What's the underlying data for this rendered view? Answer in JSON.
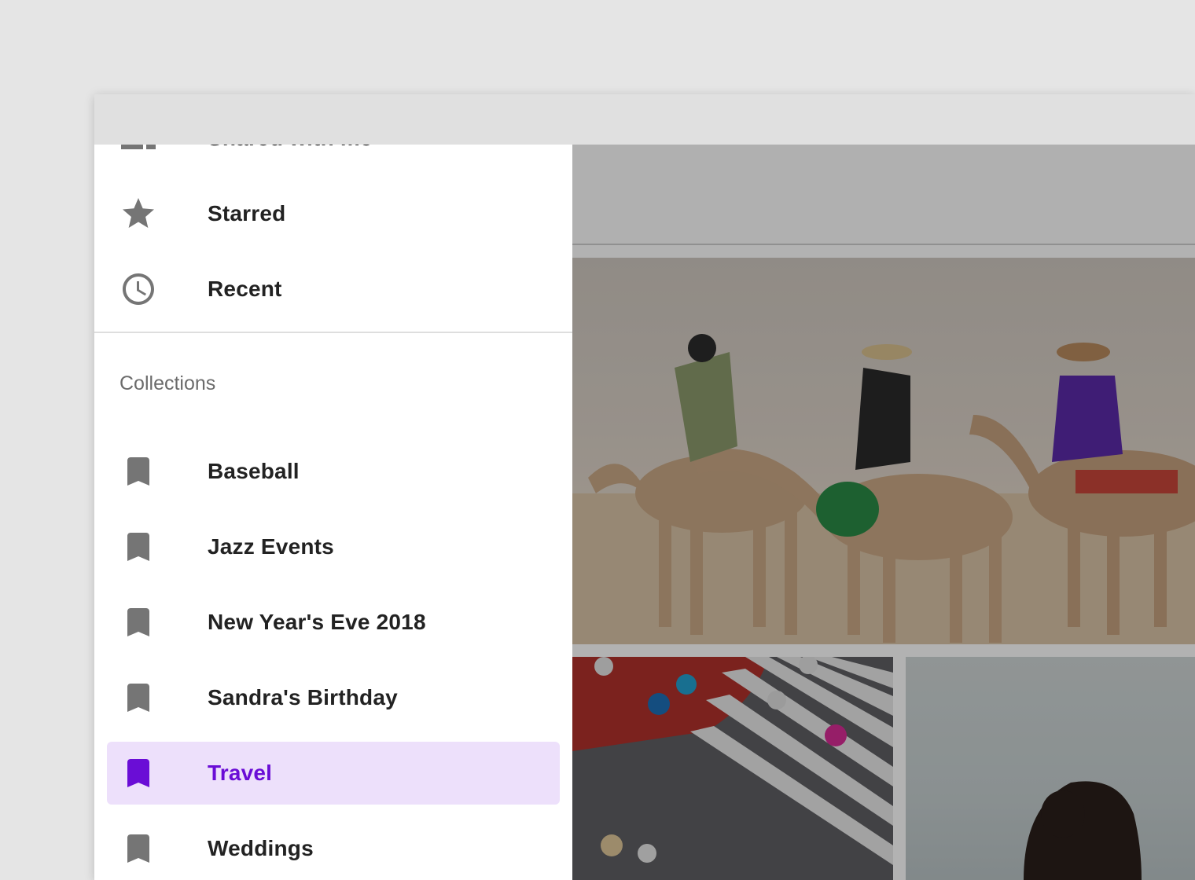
{
  "colors": {
    "accent": "#6a0dd6",
    "active_background": "#ede0fb",
    "icon_gray": "#757575",
    "text_primary": "#222222",
    "subheader_text": "#6b6b6b"
  },
  "drawer": {
    "items": [
      {
        "label": "Shared with me",
        "icon": "people-icon"
      },
      {
        "label": "Starred",
        "icon": "star-icon"
      },
      {
        "label": "Recent",
        "icon": "clock-icon"
      }
    ],
    "collections_header": "Collections",
    "collections": [
      {
        "label": "Baseball",
        "icon": "bookmark-icon",
        "active": false
      },
      {
        "label": "Jazz Events",
        "icon": "bookmark-icon",
        "active": false
      },
      {
        "label": "New Year's Eve 2018",
        "icon": "bookmark-icon",
        "active": false
      },
      {
        "label": "Sandra's Birthday",
        "icon": "bookmark-icon",
        "active": false
      },
      {
        "label": "Travel",
        "icon": "bookmark-icon",
        "active": true
      },
      {
        "label": "Weddings",
        "icon": "bookmark-icon",
        "active": false
      }
    ]
  },
  "photos": [
    {
      "subject": "camel-riders-desert"
    },
    {
      "subject": "crosswalk-umbrellas"
    },
    {
      "subject": "portrait-woman"
    }
  ]
}
